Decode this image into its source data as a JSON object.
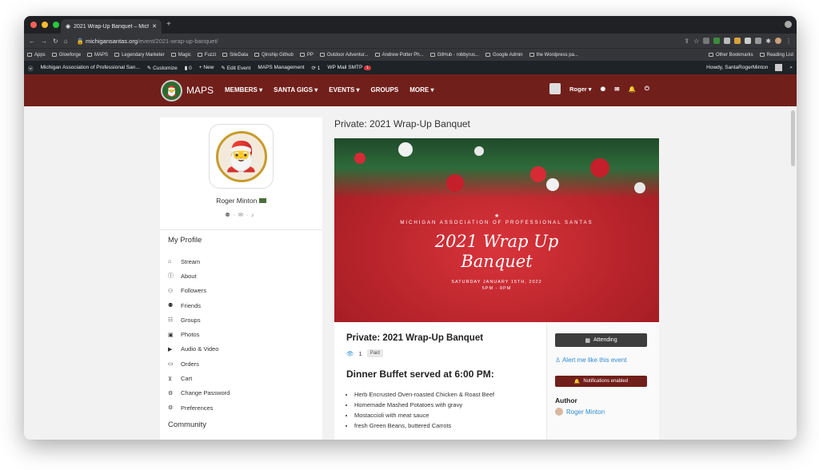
{
  "browser": {
    "tab_title": "2021 Wrap-Up Banquet – Mich",
    "url_host": "michigansantas.org",
    "url_path": "/event/2021-wrap-up-banquet/"
  },
  "bookmarks": [
    "Apps",
    "Glowforge",
    "MAPS",
    "Legendary Marketer",
    "Magic",
    "Fuzzi",
    "SiteData",
    "Qinship Github",
    "PP",
    "Outdoor Adventur...",
    "Andrew Potter Ph...",
    "GitHub - robbyrus...",
    "Google Admin",
    "the Wordpress pa...",
    "Other Bookmarks",
    "Reading List"
  ],
  "wp": {
    "site": "Michigan Association of Professional San...",
    "customize": "Customize",
    "comments": "0",
    "new": "New",
    "edit": "Edit Event",
    "maps": "MAPS Management",
    "updates": "1",
    "smtp": "WP Mail SMTP",
    "smtp_badge": "1",
    "howdy": "Howdy, SantaRogerMinton"
  },
  "nav": {
    "brand": "MAPS",
    "items": [
      "MEMBERS",
      "SANTA GIGS",
      "EVENTS",
      "GROUPS",
      "MORE"
    ],
    "user": "Roger"
  },
  "sidebar": {
    "name": "Roger Minton",
    "heading": "My Profile",
    "items": [
      {
        "label": "Stream",
        "icon": "home-icon",
        "glyph": "⌂"
      },
      {
        "label": "About",
        "icon": "info-icon",
        "glyph": "ⓘ"
      },
      {
        "label": "Followers",
        "icon": "followers-icon",
        "glyph": "⚇"
      },
      {
        "label": "Friends",
        "icon": "friends-icon",
        "glyph": "⚉"
      },
      {
        "label": "Groups",
        "icon": "groups-icon",
        "glyph": "☷"
      },
      {
        "label": "Photos",
        "icon": "camera-icon",
        "glyph": "▣"
      },
      {
        "label": "Audio & Video",
        "icon": "video-icon",
        "glyph": "▶"
      },
      {
        "label": "Orders",
        "icon": "card-icon",
        "glyph": "▭"
      },
      {
        "label": "Cart",
        "icon": "cart-icon",
        "glyph": "⊻"
      },
      {
        "label": "Change Password",
        "icon": "gear-icon",
        "glyph": "⚙"
      },
      {
        "label": "Preferences",
        "icon": "gear-icon",
        "glyph": "⚙"
      }
    ],
    "community": "Community"
  },
  "page": {
    "title": "Private: 2021 Wrap-Up Banquet"
  },
  "banner": {
    "org": "MICHIGAN ASSOCIATION OF PROFESSIONAL SANTAS",
    "line1": "2021 Wrap Up",
    "line2": "Banquet",
    "date": "SATURDAY JANUARY 15TH, 2022",
    "time": "5PM - 9PM"
  },
  "event": {
    "title": "Private: 2021 Wrap-Up Banquet",
    "views": "1",
    "paid": "Paid",
    "dinner": "Dinner Buffet served at 6:00 PM:",
    "menu": [
      "Herb Encrusted Oven-roasted Chicken & Roast Beef",
      "Homemade Mashed Potatoes with gravy",
      "Mostaccioli with meat sauce",
      "fresh Green Beans, buttered Carrots"
    ]
  },
  "actions": {
    "attending": "Attending",
    "alert": "Alert me like this event",
    "notifications": "Notifications enabled",
    "author_heading": "Author",
    "author": "Roger Minton"
  },
  "colors": {
    "nav": "#711f1b",
    "banner": "#b8242b",
    "link": "#2e8bd1"
  }
}
